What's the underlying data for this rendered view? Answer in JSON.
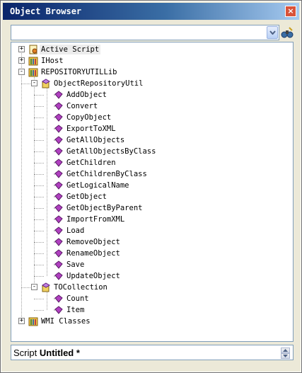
{
  "window": {
    "title": "Object Browser",
    "close_glyph": "×"
  },
  "toolbar": {
    "combo_value": "",
    "find_icon": "find-binoculars-icon"
  },
  "tree": {
    "nodes": [
      {
        "label": "Active Script",
        "icon": "script-icon",
        "expander": "+",
        "selected": true
      },
      {
        "label": "IHost",
        "icon": "library-icon",
        "expander": "+"
      },
      {
        "label": "REPOSITORYUTILLib",
        "icon": "library-icon",
        "expander": "-"
      },
      {
        "label": "ObjectRepositoryUtil",
        "icon": "class-icon",
        "expander": "-"
      },
      {
        "label": "AddObject",
        "icon": "method-icon"
      },
      {
        "label": "Convert",
        "icon": "method-icon"
      },
      {
        "label": "CopyObject",
        "icon": "method-icon"
      },
      {
        "label": "ExportToXML",
        "icon": "method-icon"
      },
      {
        "label": "GetAllObjects",
        "icon": "method-icon"
      },
      {
        "label": "GetAllObjectsByClass",
        "icon": "method-icon"
      },
      {
        "label": "GetChildren",
        "icon": "method-icon"
      },
      {
        "label": "GetChildrenByClass",
        "icon": "method-icon"
      },
      {
        "label": "GetLogicalName",
        "icon": "method-icon"
      },
      {
        "label": "GetObject",
        "icon": "method-icon"
      },
      {
        "label": "GetObjectByParent",
        "icon": "method-icon"
      },
      {
        "label": "ImportFromXML",
        "icon": "method-icon"
      },
      {
        "label": "Load",
        "icon": "method-icon"
      },
      {
        "label": "RemoveObject",
        "icon": "method-icon"
      },
      {
        "label": "RenameObject",
        "icon": "method-icon"
      },
      {
        "label": "Save",
        "icon": "method-icon"
      },
      {
        "label": "UpdateObject",
        "icon": "method-icon"
      },
      {
        "label": "TOCollection",
        "icon": "class-icon",
        "expander": "-"
      },
      {
        "label": "Count",
        "icon": "method-icon"
      },
      {
        "label": "Item",
        "icon": "method-icon"
      },
      {
        "label": "WMI Classes",
        "icon": "library-icon",
        "expander": "+"
      }
    ]
  },
  "status": {
    "prefix": "Script",
    "name": "Untitled *"
  },
  "colors": {
    "title_start": "#0a246a",
    "title_end": "#a6caf0",
    "method_purple": "#b040c0"
  }
}
